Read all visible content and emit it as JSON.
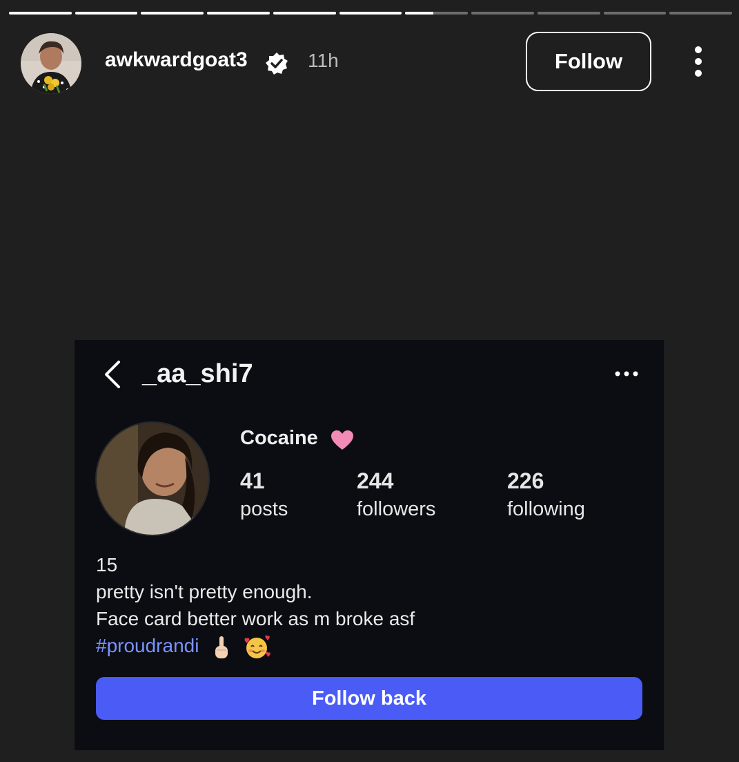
{
  "story": {
    "segments": [
      1,
      1,
      1,
      1,
      1,
      1,
      0.45,
      0,
      0,
      0,
      0
    ]
  },
  "header": {
    "username": "awkwardgoat3",
    "time": "11h",
    "follow_label": "Follow"
  },
  "card": {
    "handle": "_aa_shi7",
    "display_name": "Cocaine",
    "stats": {
      "posts": {
        "value": "41",
        "label": "posts"
      },
      "followers": {
        "value": "244",
        "label": "followers"
      },
      "following": {
        "value": "226",
        "label": "following"
      }
    },
    "bio": {
      "line1": "15",
      "line2": "pretty isn't pretty enough.",
      "line3": "Face card better work as m broke asf",
      "hashtag": "#proudrandi"
    },
    "follow_back_label": "Follow back"
  },
  "colors": {
    "accent": "#4a5cf5",
    "hashtag": "#7a93ff",
    "background": "#1f1f1f",
    "card_bg": "#0b0d13"
  },
  "icons": [
    "verified-badge-icon",
    "more-vert-icon",
    "back-arrow-icon",
    "more-horizontal-icon",
    "pink-heart-icon",
    "hand-gesture-icon",
    "smiling-hearts-icon"
  ]
}
